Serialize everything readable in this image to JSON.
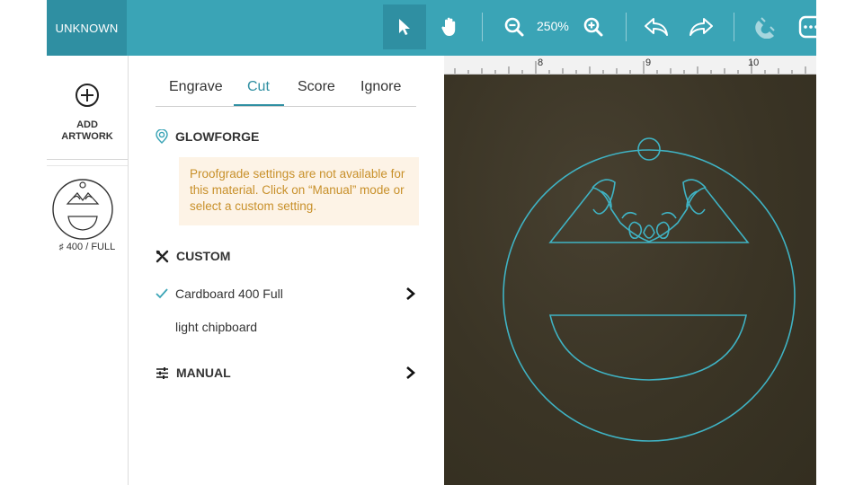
{
  "app": {
    "title": "UNKNOWN"
  },
  "toolbar": {
    "zoom_level": "250%",
    "tools": [
      {
        "name": "select-arrow-icon",
        "active": true
      },
      {
        "name": "hand-pan-icon",
        "active": false
      },
      {
        "name": "zoom-out-icon",
        "active": false
      },
      {
        "name": "zoom-in-icon",
        "active": false
      },
      {
        "name": "undo-icon",
        "active": false
      },
      {
        "name": "redo-icon",
        "active": false
      },
      {
        "name": "magnet-icon",
        "active": false
      },
      {
        "name": "more-icon",
        "active": false
      }
    ]
  },
  "sidebar": {
    "add_artwork_label": "ADD ARTWORK",
    "thumbnail_caption": "400 / FULL"
  },
  "panel": {
    "tabs": [
      {
        "label": "Engrave",
        "active": false
      },
      {
        "label": "Cut",
        "active": true
      },
      {
        "label": "Score",
        "active": false
      },
      {
        "label": "Ignore",
        "active": false
      }
    ],
    "glowforge": {
      "heading": "GLOWFORGE",
      "warning": "Proofgrade settings are not available for this material. Click on “Manual” mode or select a custom setting."
    },
    "custom": {
      "heading": "CUSTOM",
      "selected_setting": "Cardboard 400 Full",
      "material": "light chipboard"
    },
    "manual": {
      "heading": "MANUAL"
    }
  },
  "canvas": {
    "ruler_labels": [
      "8",
      "9",
      "10"
    ]
  },
  "colors": {
    "accent": "#3aa4b6",
    "accent_dark": "#2f8fa2",
    "warning_text": "#c8902a",
    "warning_bg": "#fdf3e6",
    "cut_line": "#3fb3c4",
    "material": "#3b3526"
  }
}
